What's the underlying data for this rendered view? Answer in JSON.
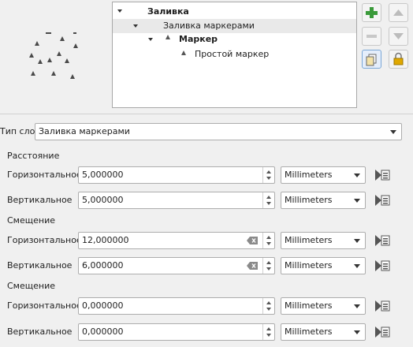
{
  "tree": {
    "items": [
      {
        "label": "Заливка",
        "bold": true
      },
      {
        "label": "Заливка маркерами",
        "bold": false
      },
      {
        "label": "Маркер",
        "bold": true
      },
      {
        "label": "Простой маркер",
        "bold": false
      }
    ]
  },
  "side_buttons": [
    {
      "icon": "add-layer-icon"
    },
    {
      "icon": "move-up-icon"
    },
    {
      "icon": "remove-layer-icon"
    },
    {
      "icon": "move-down-icon"
    },
    {
      "icon": "duplicate-layer-icon"
    },
    {
      "icon": "lock-icon"
    }
  ],
  "layer_type": {
    "label": "Тип слоя",
    "value": "Заливка маркерами"
  },
  "sections": [
    {
      "title": "Расстояние",
      "rows": [
        {
          "label": "Горизонтальное",
          "value": "5,000000",
          "unit": "Millimeters",
          "clearable": false
        },
        {
          "label": "Вертикальное",
          "value": "5,000000",
          "unit": "Millimeters",
          "clearable": false
        }
      ]
    },
    {
      "title": "Смещение",
      "rows": [
        {
          "label": "Горизонтальное",
          "value": "12,000000",
          "unit": "Millimeters",
          "clearable": true
        },
        {
          "label": "Вертикальное",
          "value": "6,000000",
          "unit": "Millimeters",
          "clearable": true
        }
      ]
    },
    {
      "title": "Смещение",
      "rows": [
        {
          "label": "Горизонтальное",
          "value": "0,000000",
          "unit": "Millimeters",
          "clearable": false
        },
        {
          "label": "Вертикальное",
          "value": "0,000000",
          "unit": "Millimeters",
          "clearable": false
        }
      ]
    }
  ],
  "colors": {
    "accent_green": "#3a9a3a",
    "lock_yellow": "#e0a800",
    "selection": "#e9e9e9"
  }
}
